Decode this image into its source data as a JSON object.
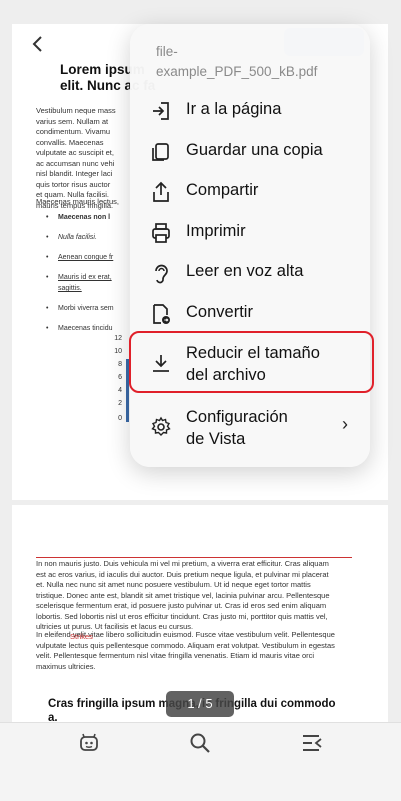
{
  "document": {
    "page1": {
      "title": "Lorem ipsum\nelit. Nunc ac fa",
      "para1": "Vestibulum neque mass\nvarius sem. Nullam at\ncondimentum. Vivamu\nconvallis. Maecenas\nvulputate ac suscipit et,\nac accumsan nunc vehi\nnisl blandit. Integer laci\nquis tortor risus auctor\net quam. Nulla facilisi.\nmauris tempus fringilla.",
      "para2": "Maecenas mauris lectus,",
      "bullets": [
        "Maecenas non l",
        "Nulla facilisi.",
        "Aenean congue fr",
        "Mauris id ex erat,\nsagittis.",
        "Morbi viverra sem",
        "Maecenas tincidu"
      ],
      "chart_ticks": [
        "12",
        "10",
        "8",
        "6",
        "4",
        "2",
        "0"
      ]
    },
    "page2": {
      "para1": "In non mauris justo. Duis vehicula mi vel mi pretium, a viverra erat efficitur. Cras aliquam\nest ac eros varius, id iaculis dui auctor. Duis pretium neque ligula, et pulvinar mi placerat\net. Nulla nec nunc sit amet nunc posuere vestibulum. Ut id neque eget tortor mattis\ntristique. Donec ante est, blandit sit amet tristique vel, lacinia pulvinar arcu. Pellentesque\nscelerisque fermentum erat, id posuere justo pulvinar ut. Cras id eros sed enim aliquam\nlobortis. Sed lobortis nisl ut eros efficitur tincidunt. Cras justo mi, porttitor quis mattis vel,\nultricies ut purus. Ut facilisis et lacus eu cursus.",
      "para2": "In eleifend velit vitae libero sollicitudin euismod. Fusce vitae vestibulum velit. Pellentesque\nvulputate lectus quis pellentesque commodo. Aliquam erat volutpat. Vestibulum in egestas\nvelit. Pellentesque fermentum nisl vitae fringilla venenatis. Etiam id mauris vitae orci\nmaximus ultricies.",
      "red_word": "Strikes",
      "heading": "Cras fringilla ipsum magna, in fringilla dui commodo\na."
    }
  },
  "page_indicator": "1 / 5",
  "menu": {
    "file_name": "file-\nexample_PDF_500_kB.pdf",
    "items": [
      {
        "label": "Ir a la página",
        "icon": "go-to-page-icon"
      },
      {
        "label": "Guardar una copia",
        "icon": "copy-icon"
      },
      {
        "label": "Compartir",
        "icon": "share-icon"
      },
      {
        "label": "Imprimir",
        "icon": "printer-icon"
      },
      {
        "label": "Leer en voz alta",
        "icon": "ear-icon"
      },
      {
        "label": "Convertir",
        "icon": "convert-icon"
      },
      {
        "label": "Reducir el tamaño\ndel archivo",
        "icon": "download-compress-icon"
      },
      {
        "label": "Configuración\nde Vista",
        "icon": "gear-icon"
      }
    ]
  },
  "bottom_bar": {
    "icons": [
      "assistant-icon",
      "search-icon",
      "outline-menu-icon"
    ]
  },
  "colors": {
    "highlight": "#e0202a",
    "accent": "#9cc5f5"
  }
}
